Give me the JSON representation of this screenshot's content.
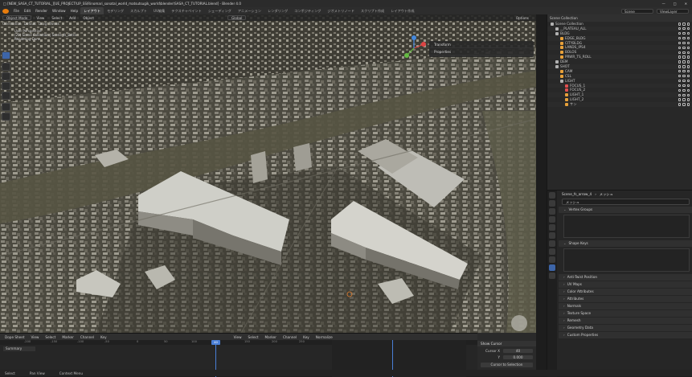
{
  "window": {
    "title": "□ [NEW_SASA_CT_TUTORIAL_][UE_PROJECT\\UP_SS\\Rinomari_sonatal_world_matsutsugik_world\\blender\\SASA_CT_TUTORIAL.blend] - Blender 4.0",
    "controls": [
      "—",
      "□",
      "✕"
    ]
  },
  "menubar": {
    "menus": [
      "File",
      "Edit",
      "Render",
      "Window",
      "Help"
    ],
    "workspaces": [
      "レイアウト",
      "モデリング",
      "スカルプト",
      "UV編集",
      "テクスチャペイント",
      "シェーディング",
      "アニメーション",
      "レンダリング",
      "コンポジティング",
      "ジオメトリノード",
      "スクリプト作成",
      "レイアウト作成"
    ],
    "active_workspace": "レイアウト",
    "scene_label": "Scene",
    "view_layer_label": "ViewLayer"
  },
  "viewport": {
    "mode": "Object Mode",
    "menus": [
      "View",
      "Select",
      "Add",
      "Object"
    ],
    "orientation": "Global",
    "sub_items": [
      "Orientation",
      "Default",
      "Drag",
      "Tweak"
    ],
    "overlay_lines": [
      "User Perspective",
      "(20) Scene Collection | Scene_fs_Extra",
      "Rendering Done"
    ],
    "options_label": "Options",
    "npanel_items": [
      "Transform",
      "Properties"
    ]
  },
  "outliner": {
    "title": "Scene Collection",
    "items": [
      {
        "label": "Scene Collection",
        "indent": 0,
        "color": "#b0b0b0"
      },
      {
        "label": "__PLATEAU_ALL",
        "indent": 1,
        "color": "#b0b0b0"
      },
      {
        "label": "BLDG",
        "indent": 1,
        "color": "#b0b0b0"
      },
      {
        "label": "EDGE_BLDG",
        "indent": 2,
        "color": "#e8a13a"
      },
      {
        "label": "CITYBLDG",
        "indent": 2,
        "color": "#e8a13a"
      },
      {
        "label": "LANDS_IPS4",
        "indent": 2,
        "color": "#e8a13a"
      },
      {
        "label": "BOLOS",
        "indent": 2,
        "color": "#e8a13a"
      },
      {
        "label": "PRWR_TS_ROLL",
        "indent": 2,
        "color": "#e8a13a"
      },
      {
        "label": "DEM",
        "indent": 1,
        "color": "#b0b0b0"
      },
      {
        "label": "SHOT",
        "indent": 1,
        "color": "#b0b0b0"
      },
      {
        "label": "CAM",
        "indent": 2,
        "color": "#e8a13a"
      },
      {
        "label": "CSL",
        "indent": 2,
        "color": "#e8a13a"
      },
      {
        "label": "LIGHT",
        "indent": 2,
        "color": "#b0b0b0"
      },
      {
        "label": "FOCUS_1",
        "indent": 3,
        "color": "#e05050"
      },
      {
        "label": "FOCUS_2",
        "indent": 3,
        "color": "#e05050"
      },
      {
        "label": "LIGHT_1",
        "indent": 3,
        "color": "#e8a13a"
      },
      {
        "label": "LIGHT_2",
        "indent": 3,
        "color": "#e8a13a"
      },
      {
        "label": "サン",
        "indent": 3,
        "color": "#e8a13a"
      }
    ]
  },
  "properties": {
    "object_name": "Scene_fs_arrow_4",
    "data_name": "メッシュ",
    "mesh_field": "メッシュ",
    "sections": [
      {
        "label": "Vertex Groups",
        "open": true
      },
      {
        "label": "Shape Keys",
        "open": true
      },
      {
        "label": "Anti-Twist Position",
        "open": false
      },
      {
        "label": "UV Maps",
        "open": false
      },
      {
        "label": "Color Attributes",
        "open": false
      },
      {
        "label": "Attributes",
        "open": false
      },
      {
        "label": "Normals",
        "open": false
      },
      {
        "label": "Texture Space",
        "open": false
      },
      {
        "label": "Remesh",
        "open": false
      },
      {
        "label": "Geometry Data",
        "open": false
      },
      {
        "label": "Custom Properties",
        "open": false
      }
    ]
  },
  "timeline": {
    "editor": "Dope Sheet",
    "menus": [
      "View",
      "Select",
      "Marker",
      "Channel",
      "Key"
    ],
    "summary": "Summary",
    "ticks": [
      "-200",
      "-150",
      "-100",
      "-50",
      "0",
      "50",
      "100",
      "150",
      "200",
      "250"
    ],
    "current_frame": "40",
    "graph_menus": [
      "View",
      "Select",
      "Marker",
      "Channel",
      "Key"
    ],
    "normalize": "Normalize",
    "side": {
      "title": "Show Cursor",
      "cursor_x_label": "Cursor X",
      "cursor_x": "40",
      "cursor_y_label": "Y",
      "cursor_y": "0.000",
      "button": "Cursor to Selection"
    }
  },
  "statusbar": {
    "items": [
      "Select",
      "Pan View",
      "Context Menu"
    ]
  }
}
